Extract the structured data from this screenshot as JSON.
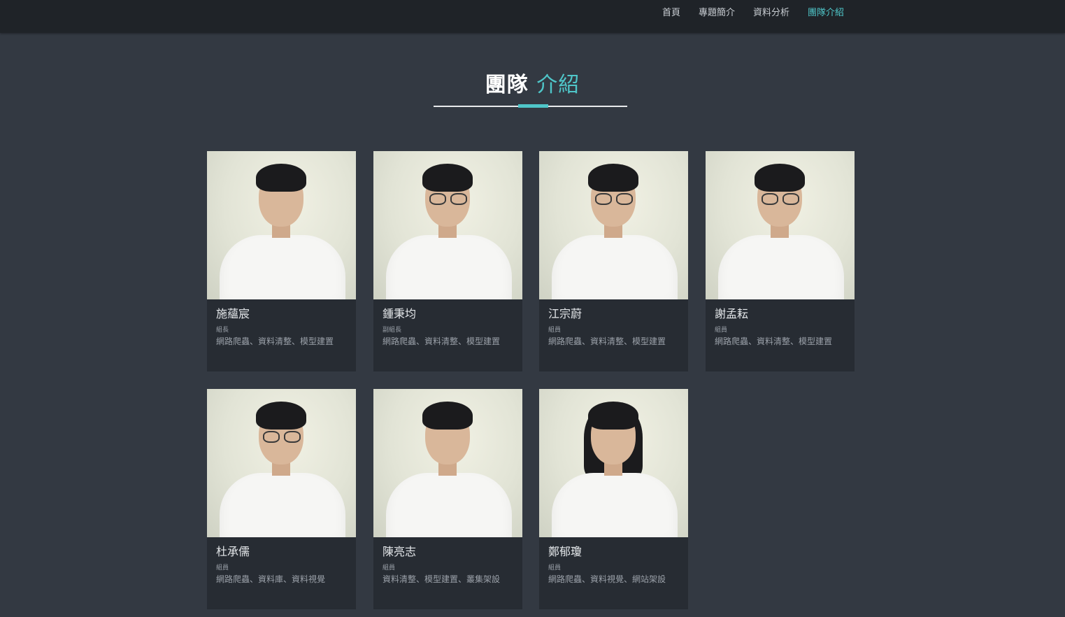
{
  "nav": {
    "items": [
      {
        "label": "首頁",
        "active": false
      },
      {
        "label": "專題簡介",
        "active": false
      },
      {
        "label": "資料分析",
        "active": false
      },
      {
        "label": "團隊介紹",
        "active": true
      }
    ]
  },
  "section": {
    "title_main": "團隊",
    "title_accent": "介紹"
  },
  "members": [
    {
      "name": "施蘊宸",
      "role": "組長",
      "skills": "網路爬蟲、資料清整、模型建置",
      "hair": "short",
      "glasses": false
    },
    {
      "name": "鍾秉均",
      "role": "副組長",
      "skills": "網路爬蟲、資料清整、模型建置",
      "hair": "short",
      "glasses": true
    },
    {
      "name": "江宗蔚",
      "role": "組員",
      "skills": "網路爬蟲、資料清整、模型建置",
      "hair": "short",
      "glasses": true
    },
    {
      "name": "謝孟耘",
      "role": "組員",
      "skills": "網路爬蟲、資料清整、模型建置",
      "hair": "short",
      "glasses": true
    },
    {
      "name": "杜承儒",
      "role": "組員",
      "skills": "網路爬蟲、資料庫、資料視覺",
      "hair": "short",
      "glasses": true
    },
    {
      "name": "陳亮志",
      "role": "組員",
      "skills": "資料清整、模型建置、叢集架設",
      "hair": "short",
      "glasses": false
    },
    {
      "name": "鄭郁瓊",
      "role": "組員",
      "skills": "網路爬蟲、資料視覺、網站架設",
      "hair": "long",
      "glasses": false
    }
  ],
  "colors": {
    "accent": "#4fc6c9",
    "background": "#333942",
    "navbar": "#1f2328",
    "card": "#272c33"
  }
}
